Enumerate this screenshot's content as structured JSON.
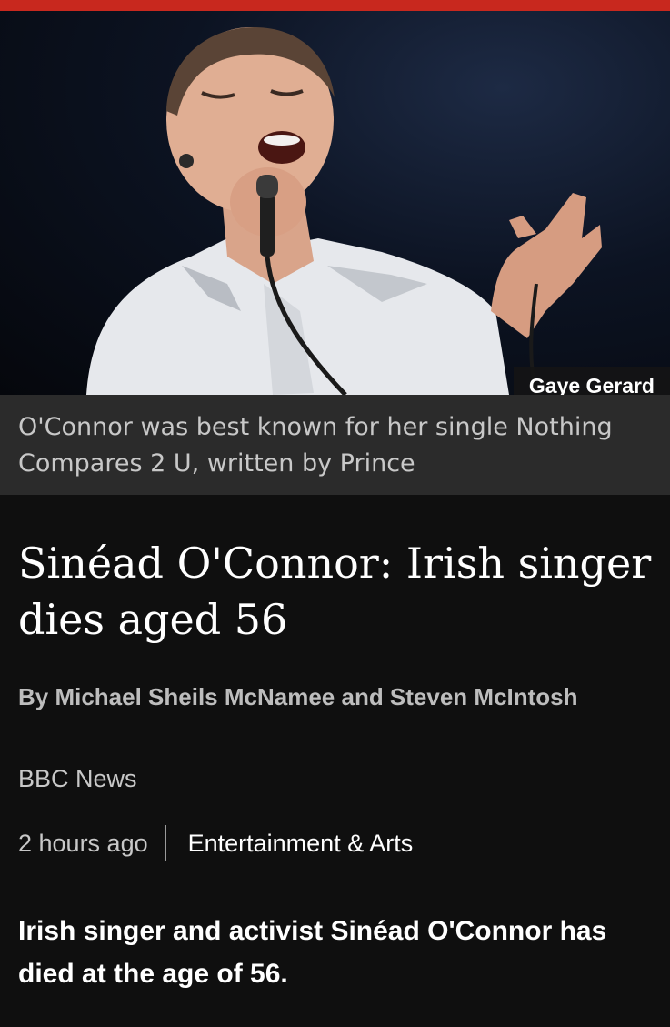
{
  "colors": {
    "accent_bar": "#c8281e",
    "background": "#0f0f0f",
    "caption_bg": "#2b2b2b"
  },
  "image": {
    "credit": "Gaye Gerard",
    "caption": "O'Connor was best known for her single Nothing Compares 2 U, written by Prince"
  },
  "article": {
    "headline": "Sinéad O'Connor: Irish singer dies aged 56",
    "byline": "By Michael Sheils McNamee and Steven McIntosh",
    "source": "BBC News",
    "time": "2 hours ago",
    "topic": "Entertainment & Arts",
    "lead": "Irish singer and activist Sinéad O'Connor has died at the age of 56."
  }
}
